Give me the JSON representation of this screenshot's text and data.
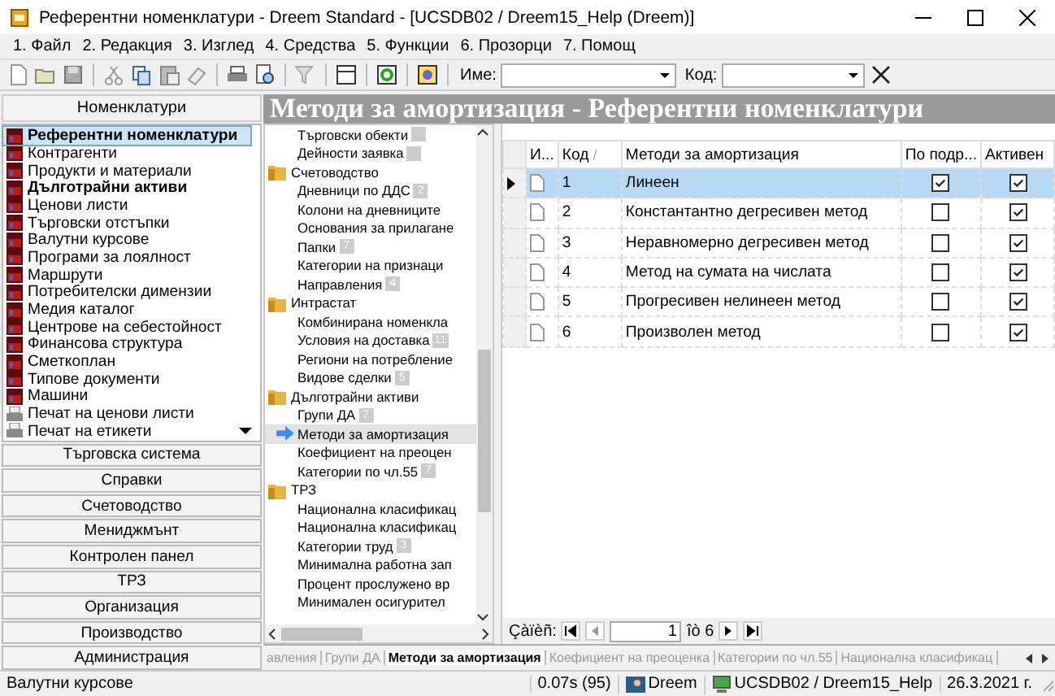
{
  "window": {
    "title": "Референтни номенклатури - Dreem Standard - [UCSDB02 / Dreem15_Help (Dreem)]"
  },
  "menu": [
    "1. Файл",
    "2. Редакция",
    "3. Изглед",
    "4. Средства",
    "5. Функции",
    "6. Прозорци",
    "7. Помощ"
  ],
  "toolbar": {
    "name_label": "Име:",
    "code_label": "Код:"
  },
  "sidebar": {
    "header": "Номенклатури",
    "items": [
      {
        "label": "Референтни номенклатури",
        "kind": "book",
        "bold": true,
        "selected": true
      },
      {
        "label": "Контрагенти",
        "kind": "book",
        "bold": false,
        "selected": false
      },
      {
        "label": "Продукти и материали",
        "kind": "book",
        "bold": false,
        "selected": false
      },
      {
        "label": "Дълготрайни активи",
        "kind": "book",
        "bold": true,
        "selected": false
      },
      {
        "label": "Ценови листи",
        "kind": "book",
        "bold": false,
        "selected": false
      },
      {
        "label": "Търговски отстъпки",
        "kind": "book",
        "bold": false,
        "selected": false
      },
      {
        "label": "Валутни курсове",
        "kind": "book",
        "bold": false,
        "selected": false
      },
      {
        "label": "Програми за лоялност",
        "kind": "book",
        "bold": false,
        "selected": false
      },
      {
        "label": "Маршрути",
        "kind": "book",
        "bold": false,
        "selected": false
      },
      {
        "label": "Потребителски димензии",
        "kind": "book",
        "bold": false,
        "selected": false
      },
      {
        "label": "Медия каталог",
        "kind": "book",
        "bold": false,
        "selected": false
      },
      {
        "label": "Центрове на себестойност",
        "kind": "book",
        "bold": false,
        "selected": false
      },
      {
        "label": "Финансова структура",
        "kind": "book",
        "bold": false,
        "selected": false
      },
      {
        "label": "Сметкоплан",
        "kind": "book",
        "bold": false,
        "selected": false
      },
      {
        "label": "Типове документи",
        "kind": "book",
        "bold": false,
        "selected": false
      },
      {
        "label": "Машини",
        "kind": "book",
        "bold": false,
        "selected": false
      },
      {
        "label": "Печат на ценови листи",
        "kind": "printer",
        "bold": false,
        "selected": false
      },
      {
        "label": "Печат на етикети",
        "kind": "printer",
        "bold": false,
        "selected": false
      }
    ],
    "sections": [
      "Търговска система",
      "Справки",
      "Счетоводство",
      "Мениджмънт",
      "Контролен панел",
      "ТРЗ",
      "Организация",
      "Производство",
      "Администрация"
    ]
  },
  "content_title": "Методи за амортизация - Референтни номенклатури",
  "tree": [
    {
      "kind": "continued",
      "children": [
        {
          "label": "Търговски обекти",
          "has_badge": true,
          "selected": false
        },
        {
          "label": "Дейности заявка",
          "has_badge": true,
          "selected": false
        }
      ]
    },
    {
      "kind": "folder",
      "label": "Счетоводство",
      "children": [
        {
          "label": "Дневници по ДДС",
          "has_badge": true,
          "badge": "2",
          "selected": false
        },
        {
          "label": "Колони на дневниците",
          "has_badge": false,
          "selected": false
        },
        {
          "label": "Основания за прилагане",
          "has_badge": false,
          "selected": false
        },
        {
          "label": "Папки",
          "has_badge": true,
          "badge": "7",
          "selected": false
        },
        {
          "label": "Категории на признаци",
          "has_badge": false,
          "selected": false
        },
        {
          "label": "Направления",
          "has_badge": true,
          "badge": "4",
          "selected": false
        }
      ]
    },
    {
      "kind": "folder",
      "label": "Интрастат",
      "children": [
        {
          "label": "Комбинирана номенкла",
          "has_badge": false,
          "selected": false
        },
        {
          "label": "Условия на доставка",
          "has_badge": true,
          "badge": "11",
          "selected": false
        },
        {
          "label": "Региони на потребление",
          "has_badge": false,
          "selected": false
        },
        {
          "label": "Видове сделки",
          "has_badge": true,
          "badge": "5",
          "selected": false
        }
      ]
    },
    {
      "kind": "folder",
      "label": "Дълготрайни активи",
      "children": [
        {
          "label": "Групи ДА",
          "has_badge": true,
          "badge": "7",
          "selected": false
        },
        {
          "label": "Методи за амортизация",
          "has_badge": false,
          "selected": true
        },
        {
          "label": "Коефициент на преоцен",
          "has_badge": false,
          "selected": false
        },
        {
          "label": "Категории по чл.55",
          "has_badge": true,
          "badge": "7",
          "selected": false
        }
      ]
    },
    {
      "kind": "folder",
      "label": "ТРЗ",
      "children": [
        {
          "label": "Национална класификац",
          "has_badge": false,
          "selected": false
        },
        {
          "label": "Национална класификац",
          "has_badge": false,
          "selected": false
        },
        {
          "label": "Категории труд",
          "has_badge": true,
          "badge": "3",
          "selected": false
        },
        {
          "label": "Минимална работна зап",
          "has_badge": false,
          "selected": false
        },
        {
          "label": "Процент прослужено вр",
          "has_badge": false,
          "selected": false
        },
        {
          "label": "Минимален осигурител",
          "has_badge": false,
          "selected": false
        }
      ]
    }
  ],
  "table": {
    "columns": [
      "И...",
      "Код",
      "Методи за амортизация",
      "По подр...",
      "Активен"
    ],
    "sort_mark": "/",
    "rows": [
      {
        "code": "1",
        "name": "Линеен",
        "default": true,
        "active": true,
        "selected": true
      },
      {
        "code": "2",
        "name": "Константантно дегресивен метод",
        "default": false,
        "active": true,
        "selected": false
      },
      {
        "code": "3",
        "name": "Неравномерно дегресивен метод",
        "default": false,
        "active": true,
        "selected": false
      },
      {
        "code": "4",
        "name": "Метод на сумата на числата",
        "default": false,
        "active": true,
        "selected": false
      },
      {
        "code": "5",
        "name": "Прогресивен нелинеен метод",
        "default": false,
        "active": true,
        "selected": false
      },
      {
        "code": "6",
        "name": "Произволен метод",
        "default": false,
        "active": true,
        "selected": false
      }
    ]
  },
  "navigator": {
    "label": "Çàïèñ:",
    "record": "1",
    "of": "îò 6"
  },
  "tabs": [
    {
      "label": "авления",
      "selected": false
    },
    {
      "label": "Групи ДА",
      "selected": false
    },
    {
      "label": "Методи за амортизация",
      "selected": true
    },
    {
      "label": "Коефициент на преоценка",
      "selected": false
    },
    {
      "label": "Категории по чл.55",
      "selected": false
    },
    {
      "label": "Национална класификац",
      "selected": false
    }
  ],
  "status_bar": {
    "message": "Валутни курсове",
    "timing": "0.07s (95)",
    "user": "Dreem",
    "database": "UCSDB02 / Dreem15_Help",
    "date": "26.3.2021 г."
  }
}
